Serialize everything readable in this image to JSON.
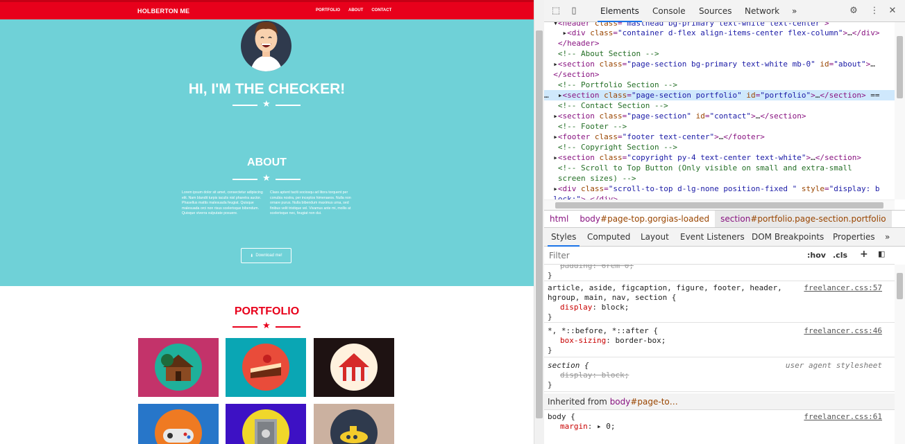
{
  "site": {
    "brand": "HOLBERTON ME",
    "nav": [
      "PORTFOLIO",
      "ABOUT",
      "CONTACT"
    ],
    "hero_title": "HI, I'M THE CHECKER!",
    "about_title": "ABOUT",
    "about_left": "Lorem ipsum dolor sit amet, consectetur adipiscing elit. Nam blandit turpis iaculis nisl pharetra auctor. Phasellus mattis malesuada feugiat. Quisque malesuada orci non risus scelerisque bibendum. Quisque viverra vulputate posuere.",
    "about_right": "Class aptent taciti sociosqu ad litora torquent per conubia nostra, per inceptos himenaeos. Nulla non ornare purus. Nulla bibendum maximus urna, sed finibus velit tristique vel. Vivamus ante mi, mollis at scelerisque nec, feugiat non dui.",
    "download_label": "Download me!",
    "portfolio_title": "PORTFOLIO",
    "colors": {
      "primary": "#6fd1d7",
      "accent": "#e8001b"
    },
    "tiles": [
      {
        "name": "cabin",
        "bg": "#c3336a",
        "circle": "#1fb09a"
      },
      {
        "name": "cake",
        "bg": "#0aa6b4",
        "circle": "#e94c3a"
      },
      {
        "name": "circus",
        "bg": "#1e1212",
        "circle": "#fff1de"
      },
      {
        "name": "game",
        "bg": "#2776c9",
        "circle": "#ef7a22"
      },
      {
        "name": "safe",
        "bg": "#3d11c4",
        "circle": "#f0d72a"
      },
      {
        "name": "submarine",
        "bg": "#cbb1a0",
        "circle": "#2f3a4d"
      }
    ]
  },
  "devtools": {
    "tabs": [
      "Elements",
      "Console",
      "Sources",
      "Network"
    ],
    "more": "»",
    "breadcrumb": [
      {
        "tag": "html",
        "cls": ""
      },
      {
        "tag": "body",
        "cls": "#page-top.gorgias-loaded"
      },
      {
        "tag": "section",
        "cls": "#portfolio.page-section.portfolio"
      }
    ],
    "styles_tabs": [
      "Styles",
      "Computed",
      "Layout",
      "Event Listeners",
      "DOM Breakpoints",
      "Properties"
    ],
    "filter_placeholder": "Filter",
    "hov": ":hov",
    "cls": ".cls",
    "rules": [
      {
        "selector": "article, aside, figcaption, figure, footer, header,",
        "selector2": "hgroup, main, nav, section {",
        "source": "freelancer.css:57",
        "prop": "display",
        "value": "block;"
      },
      {
        "selector": "*, *::before, *::after {",
        "source": "freelancer.css:46",
        "prop": "box-sizing",
        "value": "border-box;"
      },
      {
        "selector": "section {",
        "source": "user agent stylesheet",
        "prop": "display",
        "value": "block;"
      }
    ],
    "inherited_label": "Inherited from",
    "inherited_tag": "body",
    "inherited_rest": "#page-to…",
    "body_rule": {
      "selector": "body {",
      "source": "freelancer.css:61",
      "prop": "margin",
      "value": "▸ 0;"
    }
  }
}
